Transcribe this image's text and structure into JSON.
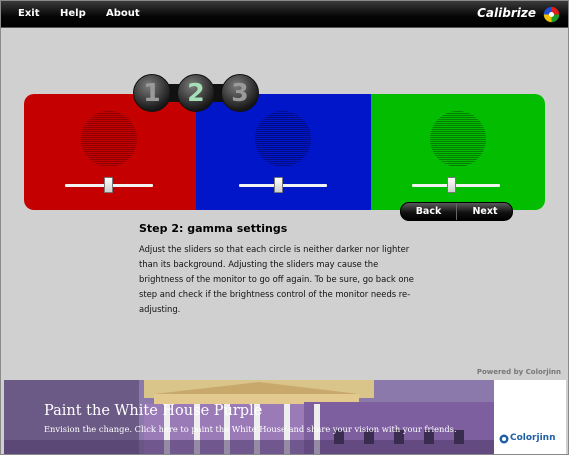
{
  "menu": {
    "exit_label": "Exit",
    "help_label": "Help",
    "about_label": "About"
  },
  "brand": {
    "name": "Calibrize"
  },
  "steps": [
    {
      "number": "1",
      "active": false
    },
    {
      "number": "2",
      "active": true
    },
    {
      "number": "3",
      "active": false
    }
  ],
  "swatches": [
    {
      "name": "red",
      "color": "#c40000",
      "circle_color": "#8f0000",
      "slider_level": 0.5
    },
    {
      "name": "blue",
      "color": "#0016c8",
      "circle_color": "#000e86",
      "slider_level": 0.45
    },
    {
      "name": "green",
      "color": "#03bd00",
      "circle_color": "#027f00",
      "slider_level": 0.45
    }
  ],
  "nav": {
    "back_label": "Back",
    "next_label": "Next"
  },
  "instructions": {
    "title": "Step 2: gamma settings",
    "body": "Adjust the sliders so that each circle is neither darker nor lighter than its background. Adjusting the sliders may cause the brightness of the monitor to go off again. To be sure, go back one step and check if the brightness control of the monitor needs re-adjusting."
  },
  "footer": {
    "powered_by": "Powered by Colorjinn"
  },
  "banner": {
    "title": "Paint the White House Purple",
    "subtitle": "Envision the change. Click here to paint the White House and share your vision with your friends.",
    "logo_text": "Colorjinn"
  }
}
